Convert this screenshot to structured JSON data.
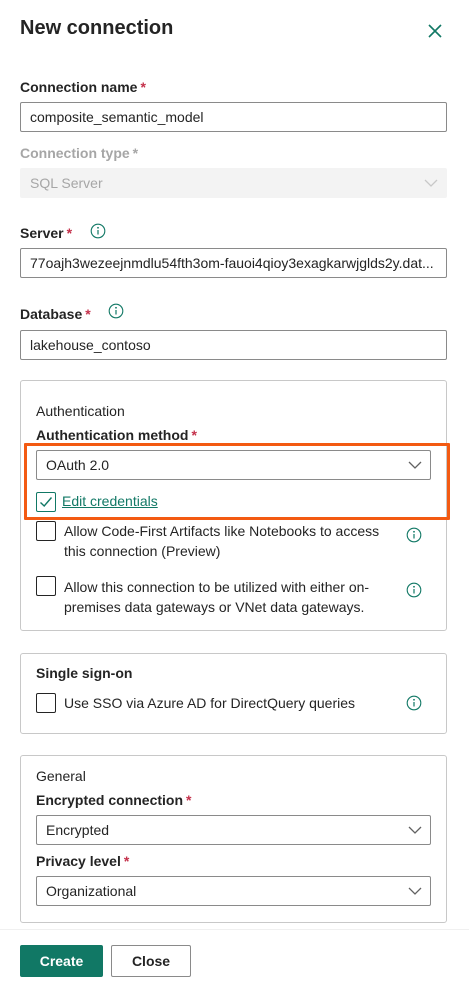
{
  "dialog": {
    "title": "New connection"
  },
  "connection_name": {
    "label": "Connection name",
    "required_mark": "*",
    "value": "composite_semantic_model"
  },
  "connection_type": {
    "label": "Connection type",
    "required_mark": "*",
    "value": "SQL Server",
    "disabled": true
  },
  "server": {
    "label": "Server",
    "required_mark": "*",
    "value": "77oajh3wezeejnmdlu54fth3om-fauoi4qioy3exagkarwjglds2y.dat..."
  },
  "database": {
    "label": "Database",
    "required_mark": "*",
    "value": "lakehouse_contoso"
  },
  "authentication": {
    "title": "Authentication",
    "method_label": "Authentication method",
    "required_mark": "*",
    "method_value": "OAuth 2.0",
    "edit_credentials": {
      "label": "Edit credentials",
      "checked": true
    },
    "options": [
      {
        "label": "Allow Code-First Artifacts like Notebooks to access this connection (Preview)",
        "checked": false
      },
      {
        "label": "Allow this connection to be utilized with either on-premises data gateways or VNet data gateways.",
        "checked": false
      }
    ]
  },
  "sso": {
    "title": "Single sign-on",
    "option": {
      "label": "Use SSO via Azure AD for DirectQuery queries",
      "checked": false
    }
  },
  "general": {
    "title": "General",
    "encrypted_label": "Encrypted connection",
    "encrypted_required_mark": "*",
    "encrypted_value": "Encrypted",
    "privacy_label": "Privacy level",
    "privacy_required_mark": "*",
    "privacy_value": "Organizational"
  },
  "footer": {
    "create_label": "Create",
    "close_label": "Close"
  },
  "colors": {
    "accent": "#117865",
    "required": "#c4314b",
    "highlight": "#f35a12"
  },
  "icons": {
    "close": "close-icon",
    "info": "info-icon",
    "chevron": "chevron-down-icon",
    "check": "checkmark-icon"
  }
}
